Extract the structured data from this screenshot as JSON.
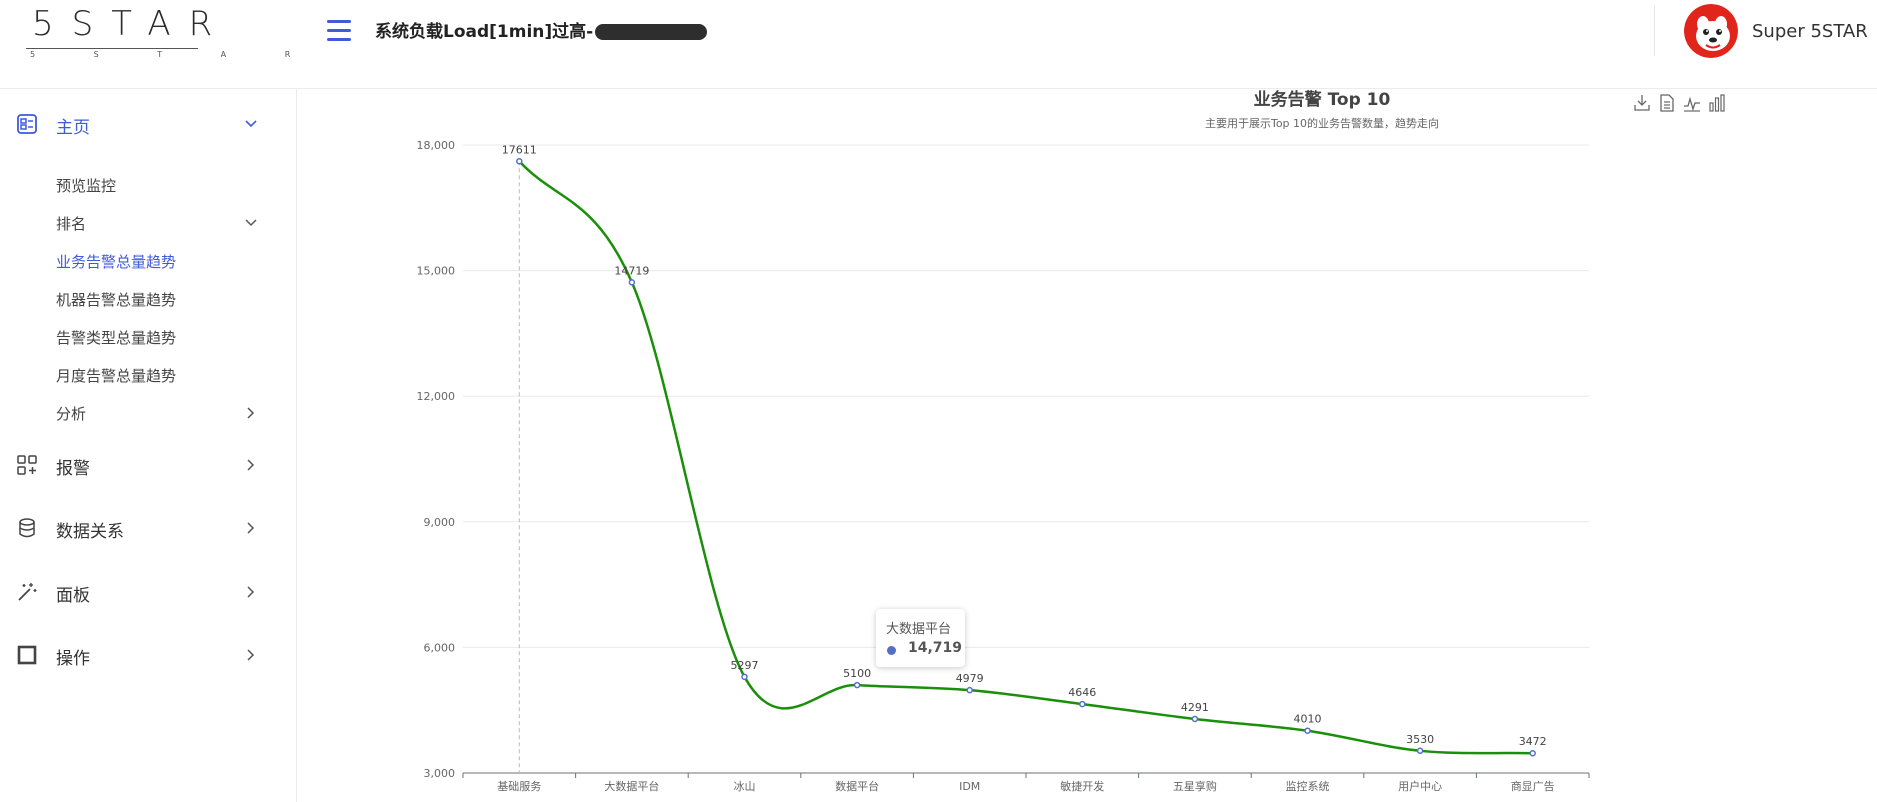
{
  "header": {
    "logo_text": "5STAR",
    "logo_subtext": "5 S T A R",
    "alert_text": "系统负载Load[1min]过高-",
    "user_name": "Super 5STAR"
  },
  "sidebar": {
    "items": [
      {
        "label": "主页",
        "icon": "dashboard-icon",
        "expanded": true
      },
      {
        "label": "报警",
        "icon": "apps-add-icon"
      },
      {
        "label": "数据关系",
        "icon": "database-icon"
      },
      {
        "label": "面板",
        "icon": "wand-icon"
      },
      {
        "label": "操作",
        "icon": "square-icon"
      }
    ],
    "sub_items": [
      {
        "label": "预览监控"
      },
      {
        "label": "排名",
        "expanded": true
      },
      {
        "label": "业务告警总量趋势",
        "active": true
      },
      {
        "label": "机器告警总量趋势"
      },
      {
        "label": "告警类型总量趋势"
      },
      {
        "label": "月度告警总量趋势"
      },
      {
        "label": "分析"
      }
    ]
  },
  "colors": {
    "accent": "#3f5bd8",
    "line": "#1a8f0a",
    "point": "#5470c6"
  },
  "chart_data": {
    "type": "line",
    "title": "业务告警 Top 10",
    "subtitle": "主要用于展示Top 10的业务告警数量，趋势走向",
    "categories": [
      "基础服务",
      "大数据平台",
      "冰山",
      "数据平台",
      "IDM",
      "敏捷开发",
      "五星享购",
      "监控系统",
      "用户中心",
      "商显广告"
    ],
    "values": [
      17611,
      14719,
      5297,
      5100,
      4979,
      4646,
      4291,
      4010,
      3530,
      3472
    ],
    "ylim": [
      3000,
      18000
    ],
    "yticks": [
      3000,
      6000,
      9000,
      12000,
      15000,
      18000
    ],
    "ytick_labels": [
      "3,000",
      "6,000",
      "9,000",
      "12,000",
      "15,000",
      "18,000"
    ],
    "smooth": true,
    "grid": true,
    "tooltip": {
      "name": "大数据平台",
      "value": "14,719"
    }
  }
}
